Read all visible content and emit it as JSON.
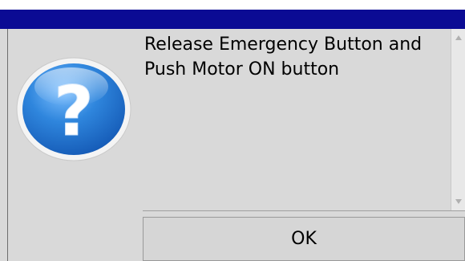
{
  "dialog": {
    "message": "Release Emergency Button and\nPush Motor ON button",
    "icon": "question-icon",
    "ok_label": "OK"
  },
  "colors": {
    "titlebar": "#0b0b94",
    "body": "#d9d9d9",
    "icon_blue": "#2a7ad5"
  }
}
